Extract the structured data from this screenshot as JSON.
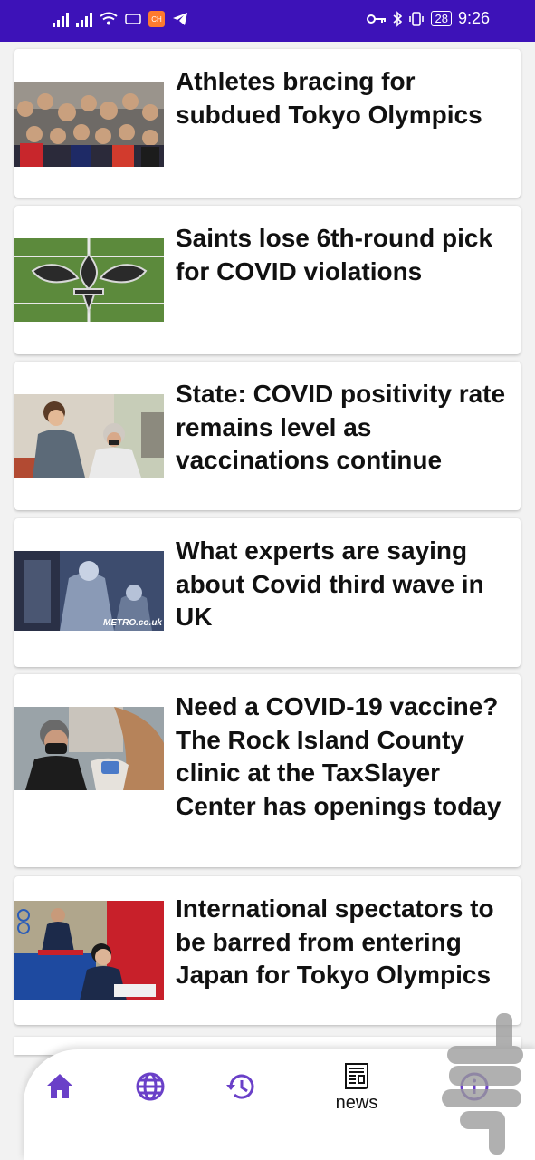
{
  "status_bar": {
    "time": "9:26",
    "battery": "28",
    "app_badge_text": "CH"
  },
  "articles": [
    {
      "headline": "Athletes bracing for subdued Tokyo Olympics"
    },
    {
      "headline": "Saints lose 6th-round pick for COVID violations"
    },
    {
      "headline": "State: COVID positivity rate remains level as vaccinations continue"
    },
    {
      "headline": "What experts are saying about Covid third wave in UK",
      "image_caption": "METRO.co.uk"
    },
    {
      "headline": "Need a COVID-19 vaccine? The Rock Island County clinic at the TaxSlayer Center has openings today"
    },
    {
      "headline": "International spectators to be barred from entering Japan for Tokyo Olympics"
    }
  ],
  "bottom_nav": {
    "news_label": "news",
    "icons": [
      "home-icon",
      "globe-icon",
      "history-icon",
      "newspaper-icon",
      "info-icon"
    ],
    "accent_color": "#6a40c8"
  },
  "colors": {
    "status_bar": "#3d12b8",
    "background": "#f2f2f2"
  }
}
